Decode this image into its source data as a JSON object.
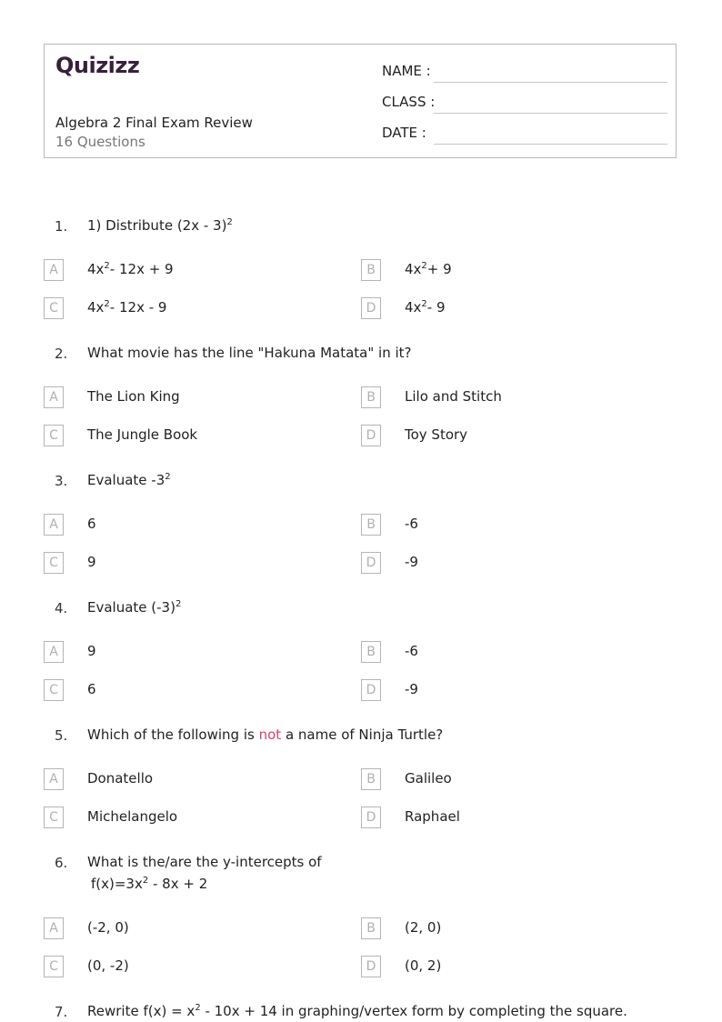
{
  "header": {
    "logo_text": "Quizizz",
    "logo_color": "#3a1f3d",
    "title": "Algebra 2 Final Exam Review",
    "subtitle": "16 Questions",
    "fields": [
      {
        "label": "NAME :"
      },
      {
        "label": "CLASS :"
      },
      {
        "label": "DATE  :"
      }
    ]
  },
  "accent_color": "#d2456b",
  "questions": [
    {
      "number": "1.",
      "text_parts": [
        {
          "t": "1)  Distribute (2x - 3)"
        },
        {
          "sup": "2"
        }
      ],
      "options": [
        {
          "letter": "A",
          "parts": [
            {
              "t": "4x"
            },
            {
              "sup": "2"
            },
            {
              "t": "- 12x + 9"
            }
          ]
        },
        {
          "letter": "B",
          "parts": [
            {
              "t": "4x"
            },
            {
              "sup": "2"
            },
            {
              "t": "+ 9"
            }
          ]
        },
        {
          "letter": "C",
          "parts": [
            {
              "t": "4x"
            },
            {
              "sup": "2"
            },
            {
              "t": "- 12x - 9"
            }
          ]
        },
        {
          "letter": "D",
          "parts": [
            {
              "t": "4x"
            },
            {
              "sup": "2"
            },
            {
              "t": "- 9"
            }
          ]
        }
      ]
    },
    {
      "number": "2.",
      "text_parts": [
        {
          "t": "What movie has the line \"Hakuna Matata\" in it?"
        }
      ],
      "options": [
        {
          "letter": "A",
          "parts": [
            {
              "t": "The Lion King"
            }
          ]
        },
        {
          "letter": "B",
          "parts": [
            {
              "t": "Lilo and Stitch"
            }
          ]
        },
        {
          "letter": "C",
          "parts": [
            {
              "t": "The Jungle Book"
            }
          ]
        },
        {
          "letter": "D",
          "parts": [
            {
              "t": "Toy Story"
            }
          ]
        }
      ]
    },
    {
      "number": "3.",
      "text_parts": [
        {
          "t": "Evaluate -3"
        },
        {
          "sup": "2"
        }
      ],
      "options": [
        {
          "letter": "A",
          "parts": [
            {
              "t": "6"
            }
          ]
        },
        {
          "letter": "B",
          "parts": [
            {
              "t": "-6"
            }
          ]
        },
        {
          "letter": "C",
          "parts": [
            {
              "t": "9"
            }
          ]
        },
        {
          "letter": "D",
          "parts": [
            {
              "t": "-9"
            }
          ]
        }
      ]
    },
    {
      "number": "4.",
      "text_parts": [
        {
          "t": "Evaluate (-3)"
        },
        {
          "sup": "2"
        }
      ],
      "options": [
        {
          "letter": "A",
          "parts": [
            {
              "t": "9"
            }
          ]
        },
        {
          "letter": "B",
          "parts": [
            {
              "t": "-6"
            }
          ]
        },
        {
          "letter": "C",
          "parts": [
            {
              "t": "6"
            }
          ]
        },
        {
          "letter": "D",
          "parts": [
            {
              "t": "-9"
            }
          ]
        }
      ]
    },
    {
      "number": "5.",
      "text_parts": [
        {
          "t": "Which of the following is "
        },
        {
          "hl": "not"
        },
        {
          "t": " a name of Ninja Turtle?"
        }
      ],
      "options": [
        {
          "letter": "A",
          "parts": [
            {
              "t": "Donatello"
            }
          ]
        },
        {
          "letter": "B",
          "parts": [
            {
              "t": "Galileo"
            }
          ]
        },
        {
          "letter": "C",
          "parts": [
            {
              "t": "Michelangelo"
            }
          ]
        },
        {
          "letter": "D",
          "parts": [
            {
              "t": "Raphael"
            }
          ]
        }
      ]
    },
    {
      "number": "6.",
      "text_parts": [
        {
          "t": "What is the/are the y-intercepts of"
        },
        {
          "br": true
        },
        {
          "t": "f(x)=3x"
        },
        {
          "sup": "2"
        },
        {
          "t": " - 8x + 2"
        }
      ],
      "options": [
        {
          "letter": "A",
          "parts": [
            {
              "t": "(-2, 0)"
            }
          ]
        },
        {
          "letter": "B",
          "parts": [
            {
              "t": "(2, 0)"
            }
          ]
        },
        {
          "letter": "C",
          "parts": [
            {
              "t": "(0, -2)"
            }
          ]
        },
        {
          "letter": "D",
          "parts": [
            {
              "t": "(0, 2)"
            }
          ]
        }
      ]
    },
    {
      "number": "7.",
      "text_parts": [
        {
          "t": "Rewrite f(x) = x"
        },
        {
          "sup": "2"
        },
        {
          "t": " - 10x + 14 in graphing/vertex form by completing the square."
        }
      ],
      "options": []
    }
  ]
}
